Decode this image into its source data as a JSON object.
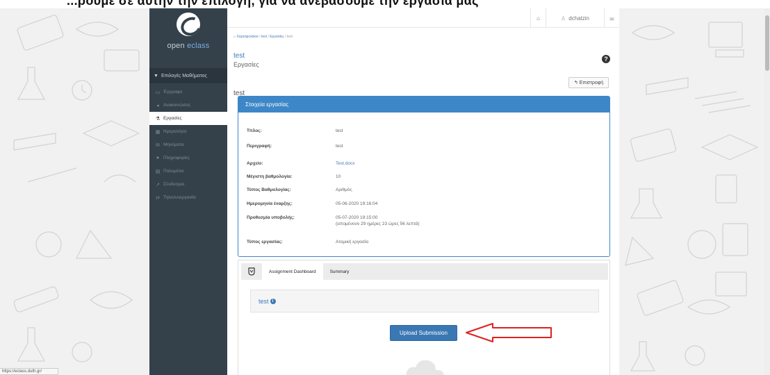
{
  "top_caption": "...ρουμε σε αυτήν την επιλογή, για να ανεβάσουμε την εργασία μας",
  "sidebar": {
    "logo_open": "open ",
    "logo_eclass": "eclass",
    "course_options": "Επιλογές Μαθήματος",
    "items": [
      {
        "label": "Έγγραφα",
        "icon": "folder-icon"
      },
      {
        "label": "Ανακοινώσεις",
        "icon": "megaphone-icon"
      },
      {
        "label": "Εργασίες",
        "icon": "flask-icon"
      },
      {
        "label": "Ημερολόγιο",
        "icon": "calendar-icon"
      },
      {
        "label": "Μηνύματα",
        "icon": "envelope-icon"
      },
      {
        "label": "Πληροφορίες",
        "icon": "info-icon"
      },
      {
        "label": "Πολυμέσα",
        "icon": "film-icon"
      },
      {
        "label": "Σύνδεσμοι",
        "icon": "link-icon"
      },
      {
        "label": "Τηλεσυνεργασία",
        "icon": "exchange-icon"
      }
    ],
    "active_index": 2
  },
  "topbar": {
    "username": "dchatzin"
  },
  "breadcrumb": {
    "home": "Χαρτοφυλάκιο",
    "course": "test",
    "section": "Εργασίες",
    "current": "test"
  },
  "page": {
    "title": "test",
    "subtitle": "Εργασίες",
    "section_name": "test",
    "back_label": "Επιστροφή"
  },
  "details": {
    "header": "Στοιχεία εργασίας",
    "rows": [
      {
        "key": "Τίτλος:",
        "value": "test"
      },
      {
        "key": "Περιγραφή:",
        "value": "test"
      },
      {
        "key": "Αρχείο:",
        "value": "Test.docx"
      },
      {
        "key": "Μέγιστη βαθμολογία:",
        "value": "10"
      },
      {
        "key": "Τύπος Βαθμολογίας:",
        "value": "Αριθμός"
      },
      {
        "key": "Ημερομηνία έναρξης:",
        "value": "05-06-2020 19:16:04"
      },
      {
        "key": "Προθεσμία υποβολής:",
        "value": "05-07-2020 19:15:00",
        "note": "(απομένουν 29 ημέρες 23 ώρες 56 λεπτά)"
      },
      {
        "key": "Τύπος εργασίας:",
        "value": "Ατομική εργασία"
      }
    ]
  },
  "dashboard": {
    "tab_dashboard": "Assignment Dashboard",
    "tab_summary": "Summary",
    "item_title": "test",
    "upload_label": "Upload Submission"
  },
  "status_bar": "https://eclass.duth.gr/",
  "colors": {
    "sidebar": "#34414b",
    "accent": "#3d86c7",
    "button": "#3a78b4",
    "arrow": "#e02020"
  }
}
